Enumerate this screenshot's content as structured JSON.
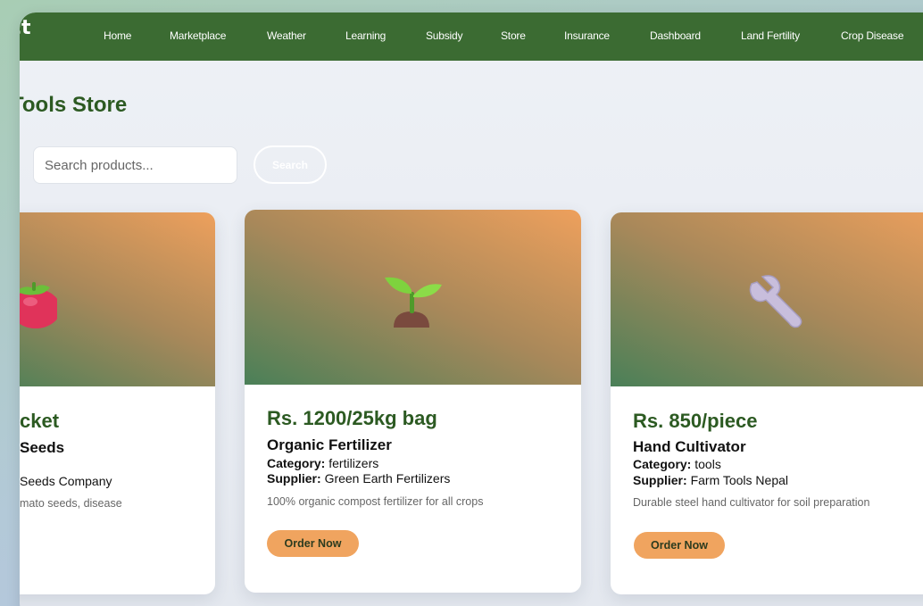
{
  "nav": {
    "brand": "ect",
    "items": [
      "Home",
      "Marketplace",
      "Weather",
      "Learning",
      "Subsidy",
      "Store",
      "Insurance",
      "Dashboard",
      "Land Fertility",
      "Crop Disease"
    ]
  },
  "page": {
    "title": "Tools Store"
  },
  "search": {
    "placeholder": "Search products...",
    "button_label": "Search"
  },
  "products": [
    {
      "price": "cket",
      "name": "Seeds",
      "supplier_value": "Seeds Company",
      "description": "mato seeds, disease",
      "icon": "tomato-icon"
    },
    {
      "price": "Rs. 1200/25kg bag",
      "name": "Organic Fertilizer",
      "category_label": "Category:",
      "category_value": "fertilizers",
      "supplier_label": "Supplier:",
      "supplier_value": "Green Earth Fertilizers",
      "description": "100% organic compost fertilizer for all crops",
      "button_label": "Order Now",
      "icon": "seedling-icon"
    },
    {
      "price": "Rs. 850/piece",
      "name": "Hand Cultivator",
      "category_label": "Category:",
      "category_value": "tools",
      "supplier_label": "Supplier:",
      "supplier_value": "Farm Tools Nepal",
      "description": "Durable steel hand cultivator for soil preparation",
      "button_label": "Order Now",
      "icon": "wrench-icon"
    }
  ],
  "colors": {
    "nav_bg": "#3b6b32",
    "accent_green": "#2c5a22",
    "order_button": "#f0a45f"
  }
}
